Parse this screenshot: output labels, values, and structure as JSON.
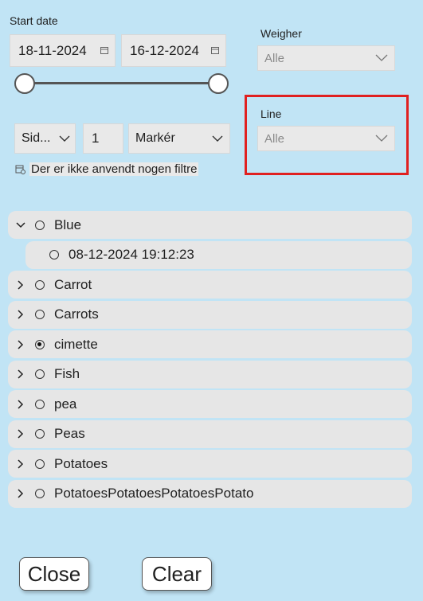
{
  "start_date_label": "Start date",
  "date_from": "18-11-2024",
  "date_to": "16-12-2024",
  "slider": {
    "start_fraction": 0.0,
    "end_fraction": 1.0
  },
  "weigher": {
    "label": "Weigher",
    "value": "Alle"
  },
  "line": {
    "label": "Line",
    "value": "Alle"
  },
  "page_controls": {
    "page_unit": "Sid...",
    "page_number": "1",
    "select": "Markér"
  },
  "filter_status": "Der er ikke anvendt nogen filtre",
  "tree": {
    "items": [
      {
        "label": "Blue",
        "expanded": true,
        "selected": false,
        "children": [
          {
            "label": "08-12-2024 19:12:23",
            "selected": false
          }
        ]
      },
      {
        "label": "Carrot",
        "expanded": false,
        "selected": false
      },
      {
        "label": "Carrots",
        "expanded": false,
        "selected": false
      },
      {
        "label": "cimette",
        "expanded": false,
        "selected": true
      },
      {
        "label": "Fish",
        "expanded": false,
        "selected": false
      },
      {
        "label": "pea",
        "expanded": false,
        "selected": false
      },
      {
        "label": "Peas",
        "expanded": false,
        "selected": false
      },
      {
        "label": "Potatoes",
        "expanded": false,
        "selected": false
      },
      {
        "label": "PotatoesPotatoesPotatoesPotato",
        "expanded": false,
        "selected": false
      }
    ]
  },
  "buttons": {
    "close": "Close",
    "clear": "Clear"
  }
}
